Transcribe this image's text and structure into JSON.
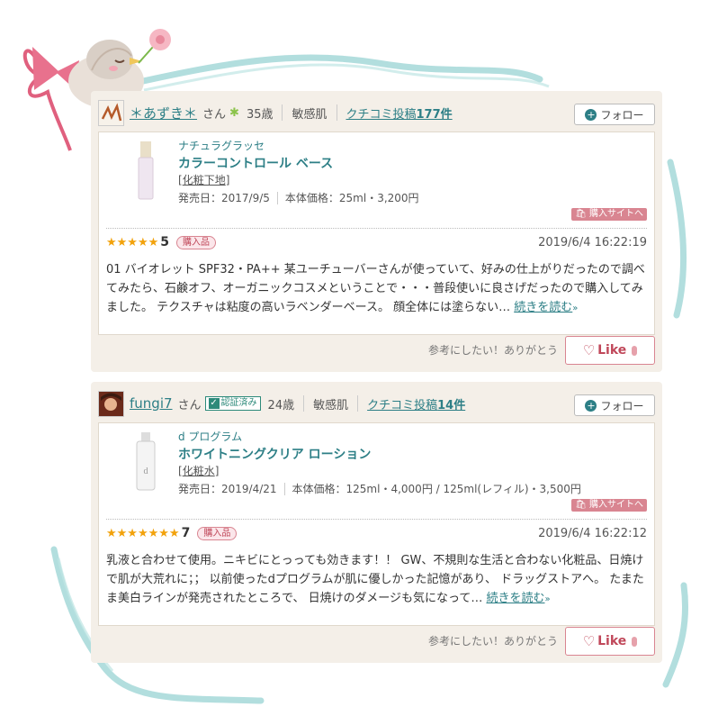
{
  "reviews": [
    {
      "name": "＊あずき＊",
      "suffix": "さん",
      "age": "35歳",
      "skin": "敏感肌",
      "posts_prefix": "クチコミ投稿",
      "posts_count": "177件",
      "follow_label": "フォロー",
      "brand": "ナチュラグラッセ",
      "product": "カラーコントロール ベース",
      "category": "化粧下地",
      "release": "発売日：2017/9/5",
      "price": "本体価格：25ml・3,200円",
      "buy_label": "購入サイトへ",
      "stars": "★★★★★",
      "score": "5",
      "bought": "購入品",
      "date": "2019/6/4 16:22:19",
      "body": "01 バイオレット SPF32・PA++ 某ユーチューバーさんが使っていて、好みの仕上がりだったので調べてみたら、石鹸オフ、オーガニックコスメということで・・・普段使いに良さげだったので購入してみました。 テクスチャは粘度の高いラベンダーベース。 顔全体には塗らない…",
      "readmore": "続きを読む",
      "helpful": "参考にしたい！ありがとう",
      "like": "Like"
    },
    {
      "name": "fungi7",
      "suffix": "さん",
      "verified": "認証済み",
      "age": "24歳",
      "skin": "敏感肌",
      "posts_prefix": "クチコミ投稿",
      "posts_count": "14件",
      "follow_label": "フォロー",
      "brand": "d プログラム",
      "product": "ホワイトニングクリア ローション",
      "category": "化粧水",
      "release": "発売日：2019/4/21",
      "price": "本体価格：125ml・4,000円 / 125ml(レフィル)・3,500円",
      "buy_label": "購入サイトへ",
      "stars": "★★★★★★★",
      "score": "7",
      "bought": "購入品",
      "date": "2019/6/4 16:22:12",
      "body": "乳液と合わせて使用。ニキビにとっっても効きます！！ GW、不規則な生活と合わない化粧品、日焼けで肌が大荒れに；； 以前使ったdプログラムが肌に優しかった記憶があり、 ドラッグストアへ。 たまたま美白ラインが発売されたところで、 日焼けのダメージも気になって…",
      "readmore": "続きを読む",
      "helpful": "参考にしたい！ありがとう",
      "like": "Like"
    }
  ],
  "colors": {
    "accent": "#2d7f86",
    "pink": "#d98591",
    "star": "#f2a20c",
    "panel": "#f4efe8"
  }
}
